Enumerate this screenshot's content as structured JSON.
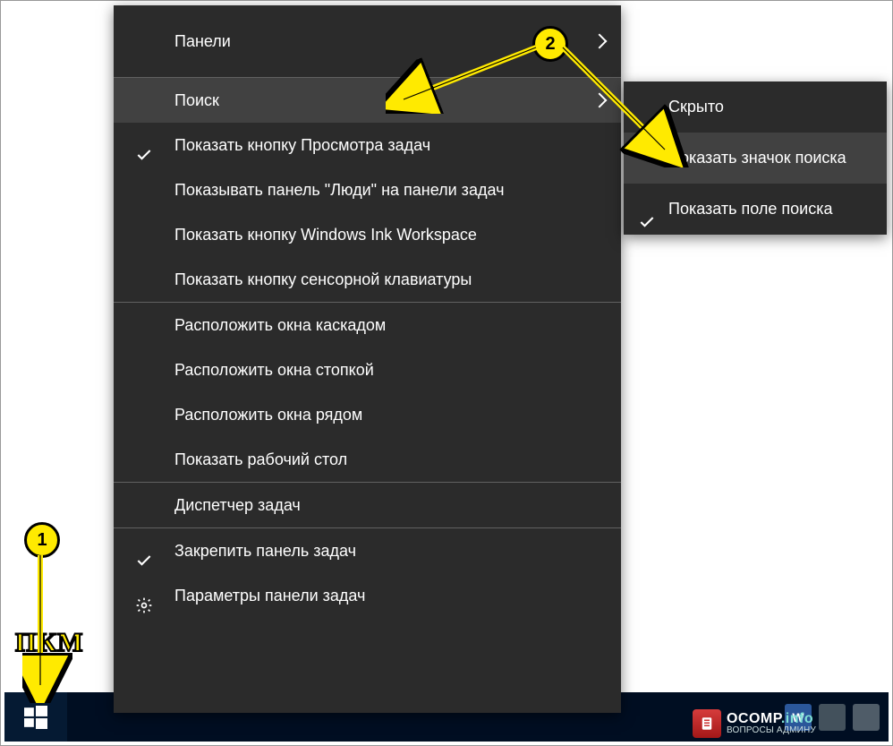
{
  "menu1": {
    "panels": "Панели",
    "search": "Поиск",
    "task_view": "Показать кнопку Просмотра задач",
    "people": "Показывать панель \"Люди\" на панели задач",
    "ink": "Показать кнопку Windows Ink Workspace",
    "touch_kbd": "Показать кнопку сенсорной клавиатуры",
    "cascade": "Расположить окна каскадом",
    "stacked": "Расположить окна стопкой",
    "side_by_side": "Расположить окна рядом",
    "show_desktop": "Показать рабочий стол",
    "task_manager": "Диспетчер задач",
    "lock_taskbar": "Закрепить панель задач",
    "taskbar_settings": "Параметры панели задач"
  },
  "menu2": {
    "hidden": "Скрыто",
    "show_icon": "Показать значок поиска",
    "show_box": "Показать поле поиска"
  },
  "annotations": {
    "num1": "1",
    "num2": "2",
    "label1": "ПКМ"
  },
  "watermark": {
    "brand_prefix": "OCOMP",
    "brand_suffix": ".info",
    "tagline": "ВОПРОСЫ АДМИНУ"
  }
}
